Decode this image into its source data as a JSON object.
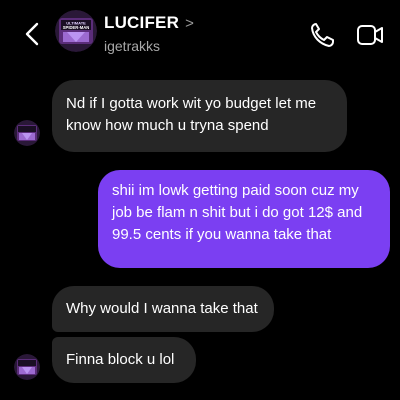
{
  "header": {
    "back_icon": "chevron-left-icon",
    "contact_name": "LUCIFER",
    "name_chevron": ">",
    "username": "igetrakks",
    "call_icon": "phone-icon",
    "video_icon": "video-camera-icon"
  },
  "avatar": {
    "logo_lines": [
      "ULTIMATE",
      "SPIDER-MAN"
    ]
  },
  "messages": [
    {
      "direction": "incoming",
      "text": "Nd if I gotta work wit yo budget let me know how much u tryna spend"
    },
    {
      "direction": "outgoing",
      "text": "shii im lowk getting paid soon cuz my job be flam n shit but i do got 12$ and 99.5 cents if you wanna take that"
    },
    {
      "direction": "incoming",
      "text": "Why would I wanna take that"
    },
    {
      "direction": "incoming",
      "text": "Finna block u lol"
    }
  ],
  "colors": {
    "background": "#000000",
    "incoming_bubble": "#262626",
    "outgoing_bubble": "#7b3ff2",
    "secondary_text": "#a8a8a8"
  }
}
